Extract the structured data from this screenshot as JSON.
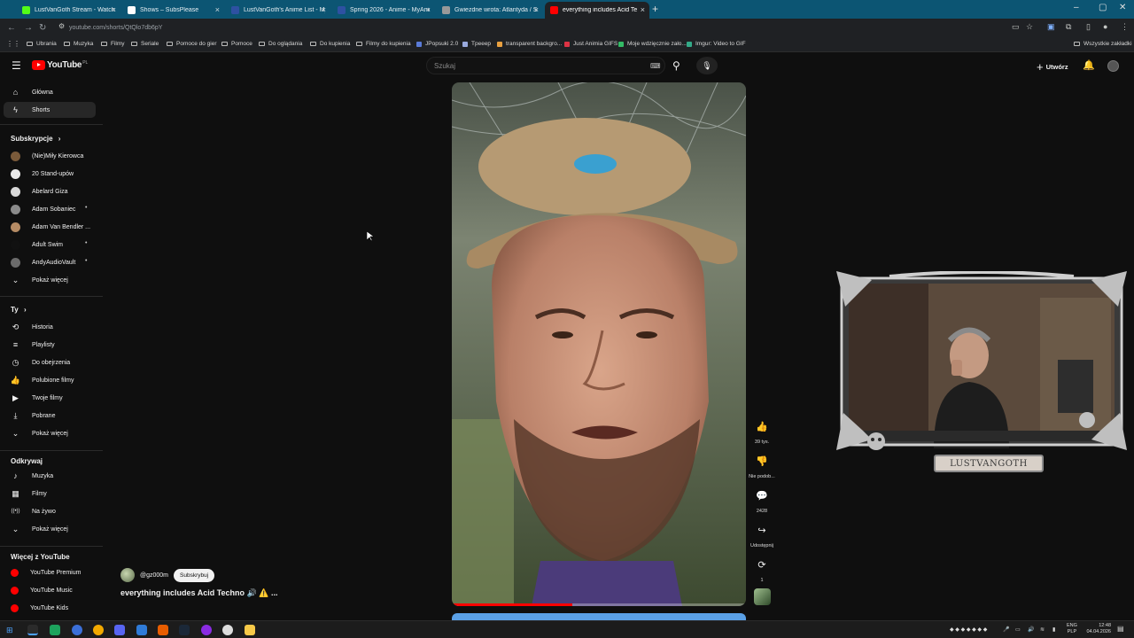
{
  "browser": {
    "tabs": [
      {
        "title": "LustVanGoth Stream - Watch L",
        "icon": "kick-icon",
        "color": "#53fc18"
      },
      {
        "title": "Shows – SubsPlease",
        "icon": "subsplease-icon",
        "color": "#ffffff"
      },
      {
        "title": "LustVanGoth's Anime List - My",
        "icon": "mal-icon",
        "color": "#2e51a2"
      },
      {
        "title": "Spring 2026 - Anime - MyAnim",
        "icon": "mal-icon",
        "color": "#2e51a2"
      },
      {
        "title": "Gwiezdne wrota: Atlantyda / St",
        "icon": "globe-icon",
        "color": "#999999"
      },
      {
        "title": "everything includes Acid Te",
        "icon": "youtube-icon",
        "color": "#ff0000"
      }
    ],
    "url": "youtube.com/shorts/QtQlo7db6pY",
    "bookmarks": [
      "Ubrania",
      "Muzyka",
      "Filmy",
      "Seriale",
      "Pomoce do gier",
      "Pomoce",
      "Do oglądania",
      "Do kupienia",
      "Filmy do kupienia",
      "JPopsuki 2.0",
      "Tpeeep",
      "transparent backgro...",
      "Just Animia GIFS",
      "Moje wdzięcznie zało...",
      "Imgur: Video to GIF"
    ],
    "all_bookmarks": "Wszystkie zakładki"
  },
  "header": {
    "logo_text": "YouTube",
    "country": "PL",
    "search_placeholder": "Szukaj",
    "create_label": "Utwórz"
  },
  "sidebar": {
    "main": [
      {
        "label": "Główna",
        "icon": "home-icon"
      },
      {
        "label": "Shorts",
        "icon": "shorts-icon",
        "selected": true
      }
    ],
    "subs_heading": "Subskrypcje",
    "subscriptions": [
      {
        "label": "(Nie)Miły Kierowca",
        "color": "#7a5a3a",
        "dot": false
      },
      {
        "label": "20 Stand-upów",
        "color": "#e8e8e8",
        "dot": false
      },
      {
        "label": "Abelard Giza",
        "color": "#d8d8d8",
        "dot": false
      },
      {
        "label": "Adam Sobaniec",
        "color": "#8b8b8b",
        "dot": true
      },
      {
        "label": "Adam Van Bendler ...",
        "color": "#b58b64",
        "dot": false
      },
      {
        "label": "Adult Swim",
        "color": "#111111",
        "dot": true
      },
      {
        "label": "AndyAudioVault",
        "color": "#6b6b6b",
        "dot": true
      }
    ],
    "more_label": "Pokaż więcej",
    "you_heading": "Ty",
    "you_items": [
      {
        "label": "Historia",
        "icon": "history-icon"
      },
      {
        "label": "Playlisty",
        "icon": "playlist-icon"
      },
      {
        "label": "Do obejrzenia",
        "icon": "clock-icon"
      },
      {
        "label": "Polubione filmy",
        "icon": "thumb-up-icon"
      },
      {
        "label": "Twoje filmy",
        "icon": "play-square-icon"
      },
      {
        "label": "Pobrane",
        "icon": "download-icon"
      },
      {
        "label": "Pokaż więcej",
        "icon": "chevron-down-icon"
      }
    ],
    "explore_heading": "Odkrywaj",
    "explore_items": [
      {
        "label": "Muzyka",
        "icon": "music-icon"
      },
      {
        "label": "Filmy",
        "icon": "film-icon"
      },
      {
        "label": "Na żywo",
        "icon": "live-icon"
      },
      {
        "label": "Pokaż więcej",
        "icon": "chevron-down-icon"
      }
    ],
    "more_yt_heading": "Więcej z YouTube",
    "more_yt_items": [
      {
        "label": "YouTube Premium"
      },
      {
        "label": "YouTube Music"
      },
      {
        "label": "YouTube Kids"
      }
    ]
  },
  "short": {
    "channel": "@gz000m",
    "subscribe_label": "Subskrybuj",
    "title": "everything includes Acid Techno 🔊 ⚠️ ...",
    "like_count": "39 tys.",
    "dislike_label": "Nie podob...",
    "comment_count": "2428",
    "share_label": "Udostępnij",
    "remix_count": "1",
    "progress": 0.41
  },
  "overlay": {
    "streamer_name": "LUSTVANGOTH"
  },
  "taskbar": {
    "lang": "ENG",
    "lang2": "PLP",
    "time": "12:48",
    "date": "04.04.2026"
  }
}
